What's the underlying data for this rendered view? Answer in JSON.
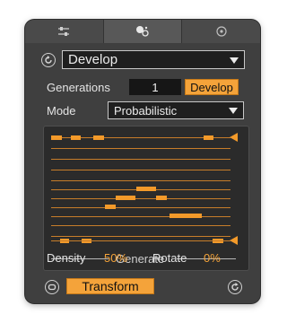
{
  "tabs": [
    {
      "icon": "sliders-icon",
      "active": false
    },
    {
      "icon": "dice-icon",
      "active": true
    },
    {
      "icon": "target-icon",
      "active": false
    }
  ],
  "mode_select": {
    "value": "Develop"
  },
  "generations": {
    "label": "Generations",
    "value": "1",
    "button": "Develop"
  },
  "mode": {
    "label": "Mode",
    "value": "Probabilistic"
  },
  "pattern": {
    "top_marker": "active-row-marker",
    "bottom_marker": "active-row-marker"
  },
  "generate": {
    "label": "Generate"
  },
  "density": {
    "label": "Density",
    "value": "50%"
  },
  "rotate": {
    "label": "Rotate",
    "value": "0%"
  },
  "footer": {
    "transform_label": "Transform"
  },
  "colors": {
    "accent": "#f4a33a",
    "panel": "#3f3f3f",
    "field": "#1f1f1f"
  }
}
